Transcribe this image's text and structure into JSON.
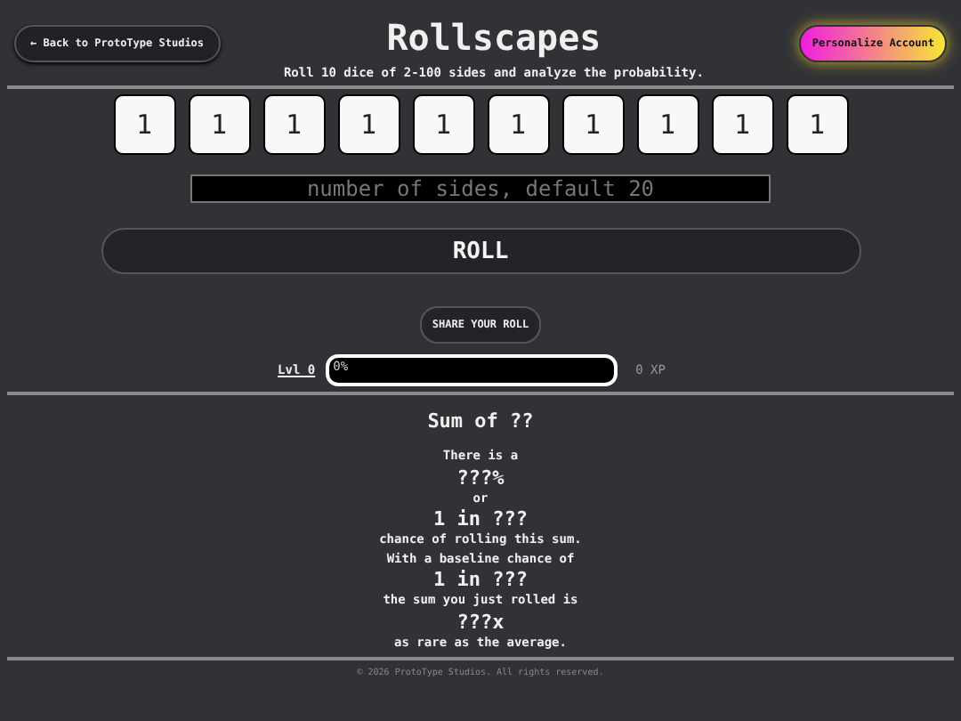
{
  "header": {
    "back_link": "← Back to ProtoType Studios",
    "title": "Rollscapes",
    "subtitle": "Roll 10 dice of 2-100 sides and analyze the probability.",
    "account_button": "Personalize Account"
  },
  "dice": [
    "1",
    "1",
    "1",
    "1",
    "1",
    "1",
    "1",
    "1",
    "1",
    "1"
  ],
  "sides_field": {
    "placeholder": "number of sides, default 20"
  },
  "roll_button": "ROLL",
  "share_button": "SHARE YOUR ROLL",
  "progress": {
    "level_link": "Lvl 0",
    "level": 0,
    "percent": "0%",
    "xp": "0 XP"
  },
  "result": {
    "heading": "Sum of ??",
    "lines": [
      {
        "kind": "text",
        "text": "There is a"
      },
      {
        "kind": "big",
        "text": "???%"
      },
      {
        "kind": "text",
        "text": "or"
      },
      {
        "kind": "big",
        "text": "1 in ???"
      },
      {
        "kind": "text",
        "text": "chance of rolling this sum."
      },
      {
        "kind": "text",
        "text": "With a baseline chance of"
      },
      {
        "kind": "big",
        "text": "1 in ???"
      },
      {
        "kind": "text",
        "text": "the sum you just rolled is"
      },
      {
        "kind": "big",
        "text": "???x"
      },
      {
        "kind": "text",
        "text": "as rare as the average."
      }
    ]
  },
  "footer": "© 2026 ProtoType Studios. All rights reserved."
}
